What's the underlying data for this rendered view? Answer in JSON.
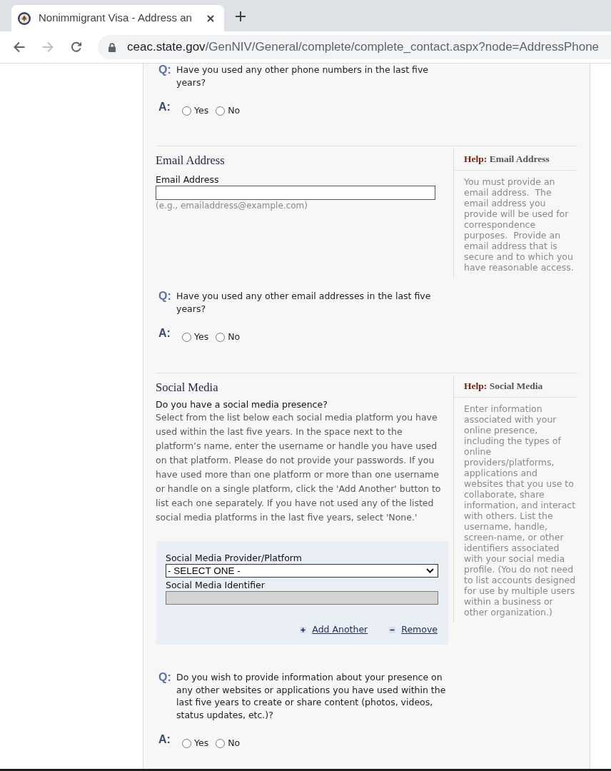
{
  "browser": {
    "tab": {
      "title": "Nonimmigrant Visa - Address an"
    },
    "address_bar": {
      "host": "ceac.state.gov",
      "path": "/GenNIV/General/complete/complete_contact.aspx?node=AddressPhone"
    }
  },
  "sections": [
    {
      "kind": "question",
      "q_mark": "Q:",
      "question": "Have you used any other phone numbers in the last five years?",
      "a_mark": "A:",
      "options": [
        {
          "label": "Yes",
          "selected": false
        },
        {
          "label": "No",
          "selected": false
        }
      ]
    },
    {
      "kind": "email",
      "heading": "Email Address",
      "field_label": "Email Address",
      "hint": "(e.g., emailaddress@example.com)",
      "help": {
        "prefix": "Help:",
        "title": "Email Address",
        "text": "You must provide an email address.  The email address you provide will be used for correspondence purposes.  Provide an email address that is secure and to which you have reasonable access."
      }
    },
    {
      "kind": "question",
      "q_mark": "Q:",
      "question": "Have you used any other email addresses in the last five years?",
      "a_mark": "A:",
      "options": [
        {
          "label": "Yes",
          "selected": false
        },
        {
          "label": "No",
          "selected": false
        }
      ]
    },
    {
      "kind": "social",
      "heading": "Social Media",
      "prompt": "Do you have a social media presence?",
      "instructions": "Select from the list below each social media platform you have used within the last five years. In the space next to the platform’s name, enter the username or handle you have used on that platform. Please do not provide your passwords. If you have used more than one platform or more than one username or handle on a single platform, click the 'Add Another' button to list each one separately. If you have not used any of the listed social media platforms in the last five years, select 'None.'",
      "form": {
        "provider_label": "Social Media Provider/Platform",
        "provider_value": "- SELECT ONE -",
        "identifier_label": "Social Media Identifier",
        "identifier_disabled": true,
        "actions": [
          {
            "kind": "add",
            "label": "Add Another"
          },
          {
            "kind": "remove",
            "label": "Remove"
          }
        ]
      },
      "help": {
        "prefix": "Help:",
        "title": "Social Media",
        "text": "Enter information associated with your online presence, including the types of online providers/platforms, applications and websites that you use to collaborate, share information, and interact with others. List the username, handle, screen-name, or other identifiers associated with your social media profile. (You do not need to list accounts designed for use by multiple users within a business or other organization.)"
      }
    },
    {
      "kind": "question",
      "q_mark": "Q:",
      "question": "Do you wish to provide information about your presence on any other websites or applications you have used within the last five years to create or share content (photos, videos, status updates, etc.)?",
      "a_mark": "A:",
      "options": [
        {
          "label": "Yes",
          "selected": false
        },
        {
          "label": "No",
          "selected": false
        }
      ]
    }
  ]
}
